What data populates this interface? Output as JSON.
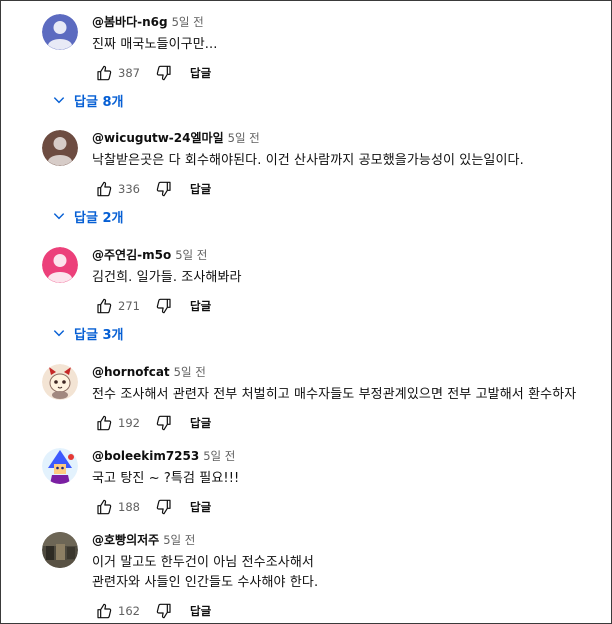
{
  "comments": [
    {
      "author": "@봄바다-n6g",
      "time": "5일 전",
      "text": "진짜 매국노들이구만...",
      "likes": "387",
      "reply_label": "답글",
      "replies_label": "답글 8개",
      "avatar_icon": "default-user-avatar",
      "avatar_color": "#5c6bc0"
    },
    {
      "author": "@wicugutw-24엘마일",
      "time": "5일 전",
      "text": "낙찰받은곳은 다 회수해야된다. 이건 산사람까지 공모했을가능성이 있는일이다.",
      "likes": "336",
      "reply_label": "답글",
      "replies_label": "답글 2개",
      "avatar_icon": "default-user-avatar",
      "avatar_color": "#6d4c41"
    },
    {
      "author": "@주연김-m5o",
      "time": "5일 전",
      "text": "김건희.  일가들. 조사해봐라",
      "likes": "271",
      "reply_label": "답글",
      "replies_label": "답글 3개",
      "avatar_icon": "default-user-avatar",
      "avatar_color": "#ec407a"
    },
    {
      "author": "@hornofcat",
      "time": "5일 전",
      "text": "전수 조사해서 관련자 전부 처벌히고 매수자들도 부정관계있으면 전부 고발해서 환수하자",
      "likes": "192",
      "reply_label": "답글",
      "avatar_icon": "cartoon-cat-avatar",
      "avatar_color": "#f3e4d4"
    },
    {
      "author": "@boleekim7253",
      "time": "5일 전",
      "text": "국고 탕진 ~ ?특검 필요!!!",
      "likes": "188",
      "reply_label": "답글",
      "avatar_icon": "character-avatar",
      "avatar_color": "#3d5afe"
    },
    {
      "author": "@호빵의저주",
      "time": "5일 전",
      "text": "이거 말고도 한두건이 아님 전수조사해서\n관련자와 사들인 인간들도 수사해야 한다.",
      "likes": "162",
      "reply_label": "답글",
      "avatar_icon": "photo-avatar",
      "avatar_color": "#4e4a3f"
    }
  ],
  "icons": {
    "like": "thumbs-up-icon",
    "dislike": "thumbs-down-icon",
    "expand": "chevron-down-icon"
  },
  "colors": {
    "link": "#065fd4",
    "secondary_text": "#606060",
    "primary_text": "#0f0f0f"
  }
}
